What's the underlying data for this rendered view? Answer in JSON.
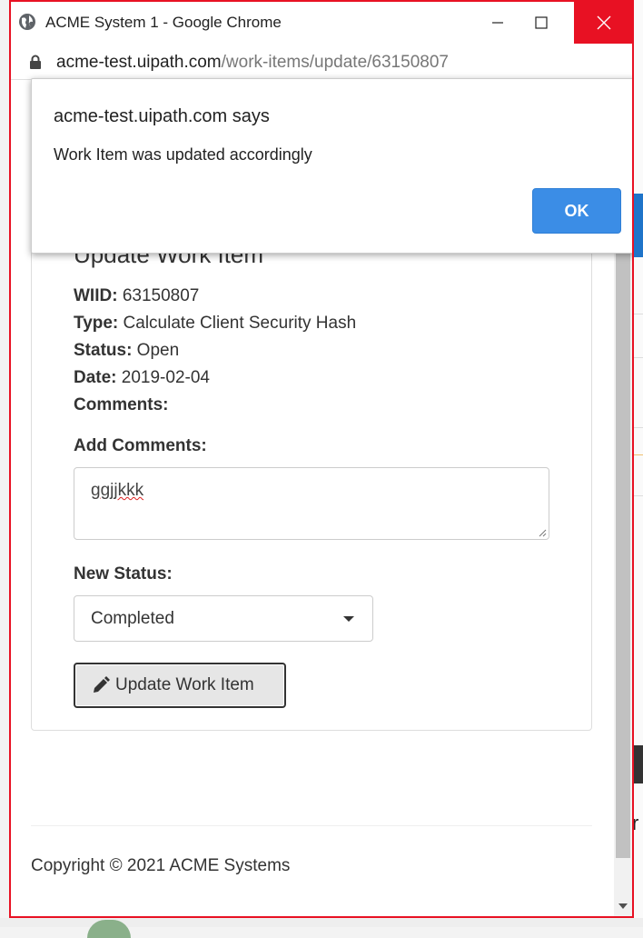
{
  "window": {
    "title": "ACME System 1 - Google Chrome",
    "url_host": "acme-test.uipath.com",
    "url_path": "/work-items/update/63150807"
  },
  "card": {
    "heading": "Update Work Item",
    "fields": [
      {
        "label": "WIID:",
        "value": " 63150807"
      },
      {
        "label": "Type:",
        "value": " Calculate Client Security Hash"
      },
      {
        "label": "Status:",
        "value": " Open"
      },
      {
        "label": "Date:",
        "value": " 2019-02-04"
      },
      {
        "label": "Comments:",
        "value": ""
      }
    ],
    "add_comments_label": "Add Comments:",
    "comment_text": "ggjjkkk",
    "new_status_label": "New Status:",
    "new_status_value": "Completed",
    "submit_label": "Update Work Item"
  },
  "footer": {
    "copyright": "Copyright © 2021 ACME Systems"
  },
  "dialog": {
    "title": "acme-test.uipath.com says",
    "message": "Work Item was updated accordingly",
    "ok_label": "OK"
  },
  "background": {
    "right_edge_text": "r"
  },
  "colors": {
    "close_red": "#e81123",
    "ok_blue": "#3b8de6"
  }
}
